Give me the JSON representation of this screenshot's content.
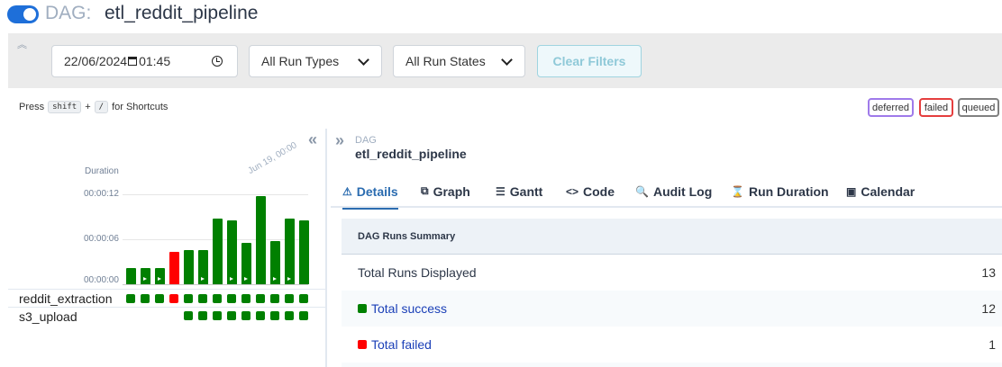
{
  "header": {
    "dag_prefix": "DAG:",
    "dag_name": "etl_reddit_pipeline",
    "toggle_on": true
  },
  "filters": {
    "date": "22/06/2024",
    "time": "01:45",
    "run_types": "All Run Types",
    "run_states": "All Run States",
    "clear_label": "Clear Filters"
  },
  "shortcuts": {
    "press": "Press",
    "key1": "shift",
    "plus": "+",
    "key2": "/",
    "suffix": "for Shortcuts"
  },
  "legend": [
    {
      "label": "deferred",
      "color": "#9f7aea"
    },
    {
      "label": "failed",
      "color": "#e53e3e"
    },
    {
      "label": "queued",
      "color": "#808080"
    }
  ],
  "grid": {
    "duration_label": "Duration",
    "y_ticks": [
      "00:00:12",
      "00:00:06",
      "00:00:00"
    ],
    "date_label": "Jun 19, 00:00",
    "runs": [
      {
        "state": "success",
        "duration_s": 2.2,
        "play": false
      },
      {
        "state": "success",
        "duration_s": 2.2,
        "play": true
      },
      {
        "state": "success",
        "duration_s": 2.2,
        "play": true
      },
      {
        "state": "failed",
        "duration_s": 4.3,
        "play": false
      },
      {
        "state": "success",
        "duration_s": 4.5,
        "play": false
      },
      {
        "state": "success",
        "duration_s": 4.6,
        "play": true
      },
      {
        "state": "success",
        "duration_s": 8.8,
        "play": false
      },
      {
        "state": "success",
        "duration_s": 8.5,
        "play": true
      },
      {
        "state": "success",
        "duration_s": 5.5,
        "play": true
      },
      {
        "state": "success",
        "duration_s": 11.8,
        "play": false
      },
      {
        "state": "success",
        "duration_s": 5.8,
        "play": true
      },
      {
        "state": "success",
        "duration_s": 8.8,
        "play": true
      },
      {
        "state": "success",
        "duration_s": 8.5,
        "play": false
      }
    ],
    "tasks": [
      {
        "name": "reddit_extraction",
        "states": [
          "success",
          "success",
          "success",
          "failed",
          "success",
          "success",
          "success",
          "success",
          "success",
          "success",
          "success",
          "success",
          "success"
        ]
      },
      {
        "name": "s3_upload",
        "states": [
          "",
          "",
          "",
          "",
          "success",
          "success",
          "success",
          "success",
          "success",
          "success",
          "success",
          "success",
          "success"
        ]
      }
    ],
    "colors": {
      "success": "#008000",
      "failed": "#ff0000"
    }
  },
  "breadcrumb": {
    "label": "DAG",
    "name": "etl_reddit_pipeline"
  },
  "tabs": [
    {
      "label": "Details",
      "icon": "warning-triangle-icon",
      "glyph": "⚠",
      "active": true
    },
    {
      "label": "Graph",
      "icon": "graph-icon",
      "glyph": "⧉",
      "active": false
    },
    {
      "label": "Gantt",
      "icon": "gantt-icon",
      "glyph": "☰",
      "active": false
    },
    {
      "label": "Code",
      "icon": "code-icon",
      "glyph": "<>",
      "active": false
    },
    {
      "label": "Audit Log",
      "icon": "audit-log-icon",
      "glyph": "🔍",
      "active": false
    },
    {
      "label": "Run Duration",
      "icon": "hourglass-icon",
      "glyph": "⌛",
      "active": false
    },
    {
      "label": "Calendar",
      "icon": "calendar-icon",
      "glyph": "▣",
      "active": false
    }
  ],
  "summary": {
    "title": "DAG Runs Summary",
    "rows": [
      {
        "label": "Total Runs Displayed",
        "value": "13",
        "color": "",
        "link": false
      },
      {
        "label": "Total success",
        "value": "12",
        "color": "#008000",
        "link": true
      },
      {
        "label": "Total failed",
        "value": "1",
        "color": "#ff0000",
        "link": true
      }
    ]
  }
}
